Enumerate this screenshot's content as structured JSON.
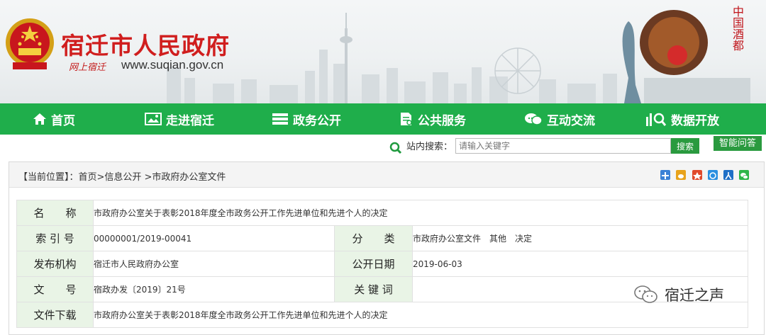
{
  "header": {
    "site_title": "宿迁市人民政府",
    "slogan": "网上宿迁",
    "domain": "www.suqian.gov.cn",
    "side_text": "中国酒都"
  },
  "nav": {
    "items": [
      {
        "label": "首页",
        "icon": "home-icon"
      },
      {
        "label": "走进宿迁",
        "icon": "image-icon"
      },
      {
        "label": "政务公开",
        "icon": "stack-icon"
      },
      {
        "label": "公共服务",
        "icon": "document-icon"
      },
      {
        "label": "互动交流",
        "icon": "chat-icon"
      },
      {
        "label": "数据开放",
        "icon": "data-icon"
      }
    ]
  },
  "search": {
    "label": "站内搜索：",
    "placeholder": "请输入关键字",
    "button": "搜索",
    "qa_button": "智能问答"
  },
  "breadcrumb": {
    "prefix": "【当前位置】：",
    "path": "首页>信息公开 >市政府办公室文件"
  },
  "share_icons": [
    "add-icon",
    "weibo-icon",
    "qzone-icon",
    "pengyou-icon",
    "renren-icon",
    "wechat-icon"
  ],
  "meta_table": {
    "name_label": "名　　称",
    "name_value": "市政府办公室关于表彰2018年度全市政务公开工作先进单位和先进个人的决定",
    "index_label": "索 引 号",
    "index_value": "00000001/2019-00041",
    "category_label": "分　　类",
    "category_value": "市政府办公室文件　其他　决定",
    "publisher_label": "发布机构",
    "publisher_value": "宿迁市人民政府办公室",
    "date_label": "公开日期",
    "date_value": "2019-06-03",
    "docno_label": "文　　号",
    "docno_value": "宿政办发〔2019〕21号",
    "keywords_label": "关 键 词",
    "keywords_value": "",
    "download_label": "文件下载",
    "download_value": "市政府办公室关于表彰2018年度全市政务公开工作先进单位和先进个人的决定"
  },
  "watermark": "宿迁之声",
  "colors": {
    "nav_green": "#1fae4b",
    "title_red": "#d01e1e",
    "label_bg": "#e9f4e6",
    "button_green": "#2a9a3f"
  }
}
